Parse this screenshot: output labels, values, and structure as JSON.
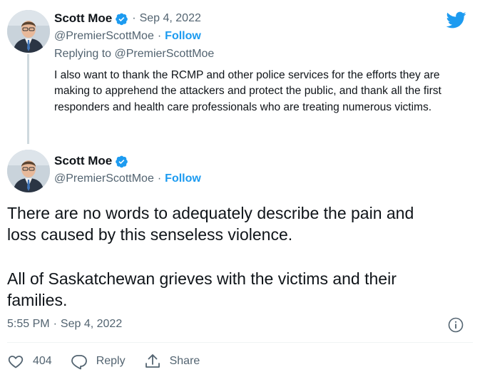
{
  "colors": {
    "accent": "#1d9bf0",
    "muted": "#536471",
    "text": "#0f1419"
  },
  "parent_tweet": {
    "author_name": "Scott Moe",
    "separator": "·",
    "date": "Sep 4, 2022",
    "handle": "@PremierScottMoe",
    "handle_separator": "·",
    "follow_label": "Follow",
    "replying_to": "Replying to @PremierScottMoe",
    "text": "I also want to thank the RCMP and other police services for the efforts they are making to apprehend the attackers and protect the public, and thank all the first responders and health care professionals who are treating numerous victims."
  },
  "main_tweet": {
    "author_name": "Scott Moe",
    "handle": "@PremierScottMoe",
    "handle_separator": "·",
    "follow_label": "Follow",
    "paragraph_1_line_1": "There are no words to adequately describe the pain and",
    "paragraph_1_line_2": "loss caused by this senseless violence.",
    "paragraph_2_line_1": "All of Saskatchewan grieves with the victims and their",
    "paragraph_2_line_2": "families.",
    "time": "5:55 PM",
    "meta_separator": "·",
    "date": "Sep 4, 2022"
  },
  "actions": {
    "like_count": "404",
    "reply_label": "Reply",
    "share_label": "Share"
  },
  "icons": [
    "twitter-bird-icon",
    "verified-badge-icon",
    "info-icon",
    "heart-icon",
    "reply-icon",
    "share-icon"
  ]
}
